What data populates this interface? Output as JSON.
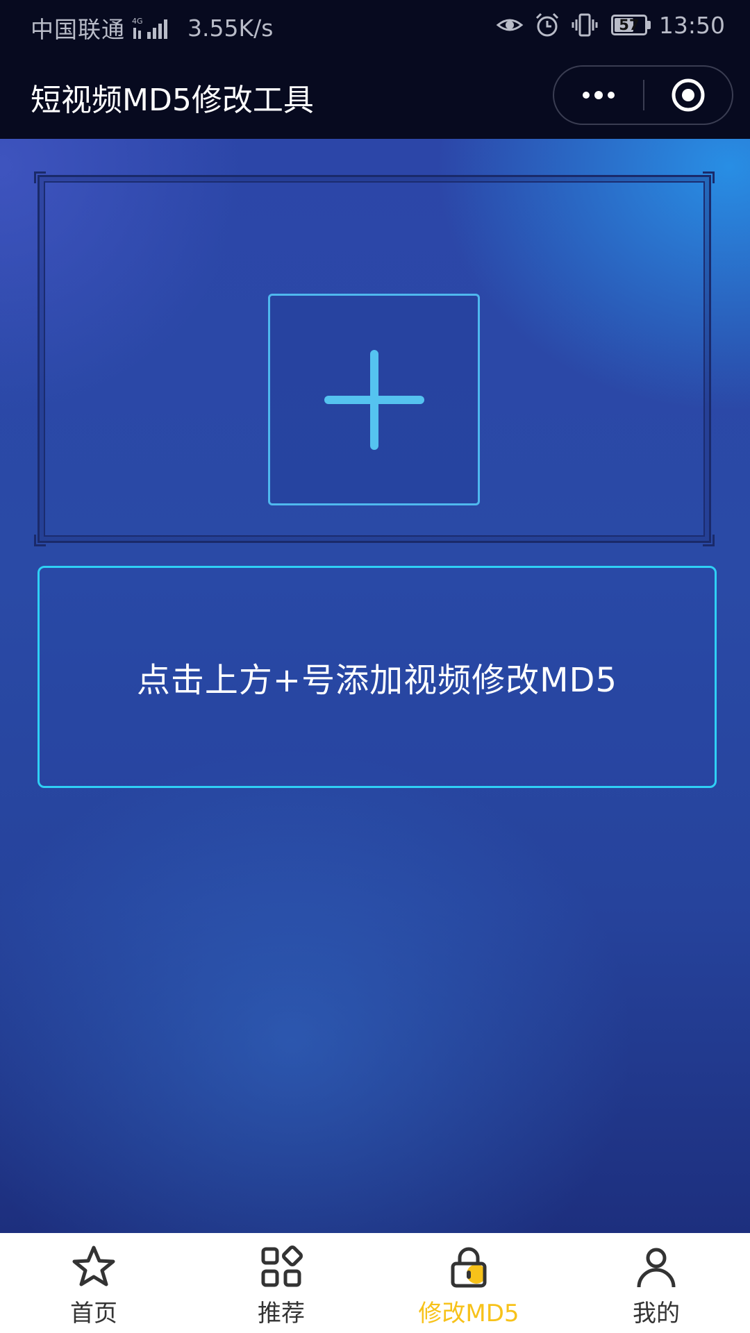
{
  "status_bar": {
    "carrier": "中国联通",
    "network": "4G",
    "speed": "3.55K/s",
    "battery": "57",
    "time": "13:50",
    "icons": [
      "eye-icon",
      "alarm-icon",
      "vibrate-icon"
    ]
  },
  "header": {
    "title": "短视频MD5修改工具",
    "more_icon": "more-dots-icon",
    "close_icon": "target-circle-icon"
  },
  "main": {
    "add_icon": "plus-icon",
    "hint": "点击上方+号添加视频修改MD5"
  },
  "tabbar": {
    "active_index": 2,
    "active_color": "#f7c21a",
    "items": [
      {
        "label": "首页",
        "icon": "star-icon"
      },
      {
        "label": "推荐",
        "icon": "grid-icon"
      },
      {
        "label": "修改MD5",
        "icon": "lock-icon"
      },
      {
        "label": "我的",
        "icon": "user-icon"
      }
    ]
  },
  "colors": {
    "accent_cyan": "#2fd0f5",
    "plus_blue": "#4fb8ee",
    "bar_dark": "#070a1f"
  }
}
